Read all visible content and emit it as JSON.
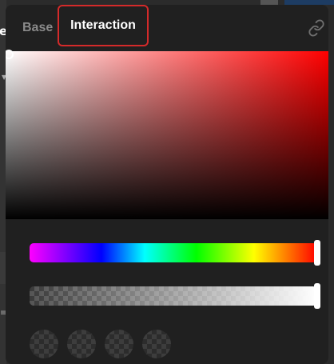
{
  "background": {
    "left_text": "e"
  },
  "picker": {
    "tabs": [
      {
        "label": "Base",
        "active": false
      },
      {
        "label": "Interaction",
        "active": true
      }
    ],
    "link_icon": "link-icon",
    "hue": 0,
    "alpha": 1,
    "saturation_value_handle": "top-left",
    "swatch_count": 4
  },
  "colors": {
    "panel_bg": "#202020",
    "highlight_border": "#d42a2a",
    "active_tab_text": "#ffffff",
    "inactive_tab_text": "#8a8a8a",
    "hue_base": "#ff0000"
  }
}
